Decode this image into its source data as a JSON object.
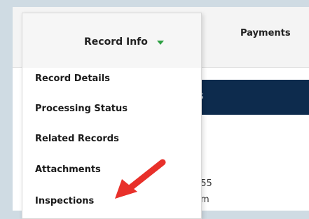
{
  "nav": {
    "record_info_label": "Record Info",
    "payments_label": "Payments"
  },
  "menu": {
    "items": [
      {
        "label": "Record Details"
      },
      {
        "label": "Processing Status"
      },
      {
        "label": "Related Records"
      },
      {
        "label": "Attachments"
      },
      {
        "label": "Inspections"
      }
    ]
  },
  "background": {
    "bluebar_text": "s",
    "phone_fragment": "555",
    "email_fragment": "om"
  },
  "colors": {
    "caret": "#2ea043",
    "arrow": "#e8302a",
    "header_bar": "#0d2b4d"
  },
  "icons": {
    "dropdown": "caret-down-icon",
    "annotation": "red-arrow-icon"
  }
}
